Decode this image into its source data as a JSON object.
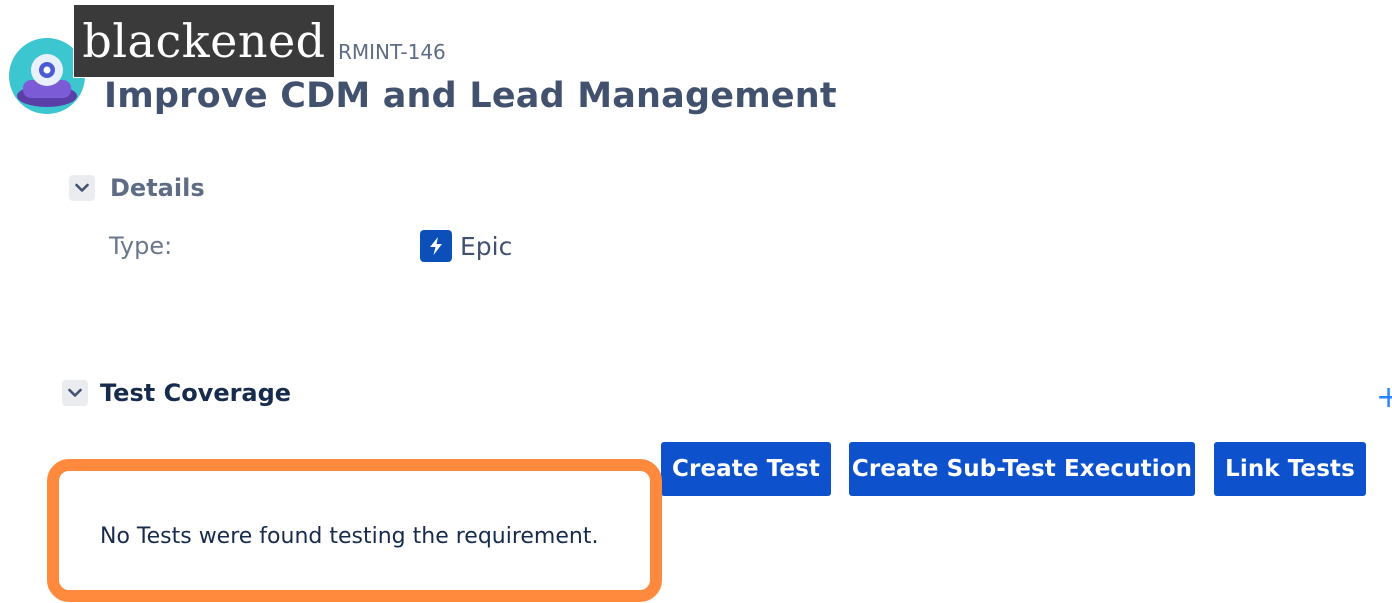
{
  "header": {
    "redaction_label": "blackened",
    "issue_key": "RMINT-146",
    "title": "Improve CDM and Lead Management",
    "avatar_icon": "project-avatar-icon"
  },
  "details": {
    "section_label": "Details",
    "toggle_icon": "chevron-down-icon",
    "type_label": "Type:",
    "type_value": "Epic",
    "type_icon": "epic-lightning-icon"
  },
  "test_coverage": {
    "section_label": "Test Coverage",
    "toggle_icon": "chevron-down-icon",
    "add_icon": "plus-icon",
    "buttons": {
      "create_test": "Create Test",
      "create_sub_test_execution": "Create Sub-Test Execution",
      "link_tests": "Link Tests"
    },
    "empty_message": "No Tests were found testing the requirement."
  },
  "colors": {
    "button_primary": "#0d52cc",
    "highlight_border": "#ff8a3d",
    "epic_icon": "#0c4fb8",
    "avatar_bg": "#3cc6d0"
  }
}
